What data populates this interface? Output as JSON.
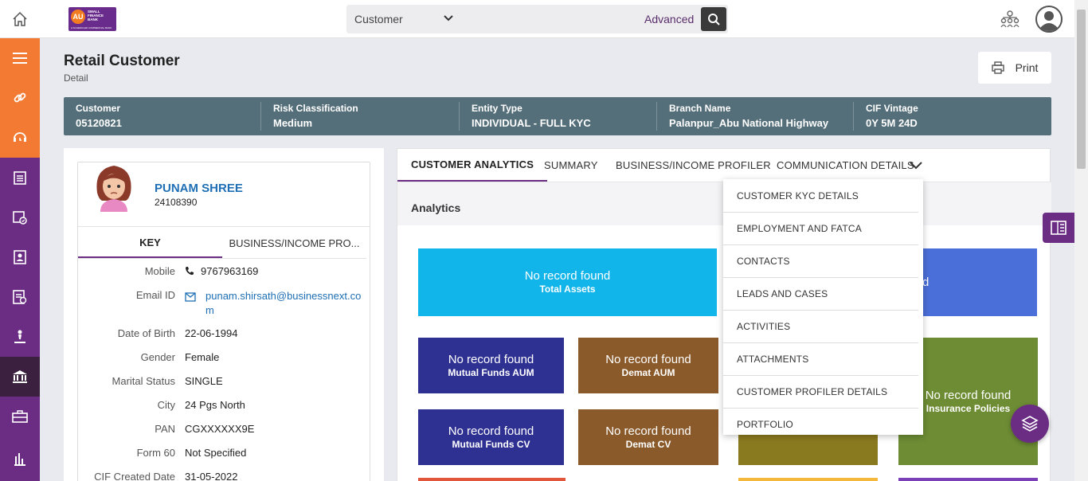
{
  "topbar": {
    "search_scope": "Customer",
    "search_placeholder": "",
    "advanced_label": "Advanced",
    "logo_text": "AU",
    "logo_bank": "SMALL FINANCE BANK",
    "logo_tagline": "A SCHEDULED COMMERCIAL BANK"
  },
  "sidebar": {
    "items": [
      {
        "icon": "menu-icon",
        "color": "#f37a33"
      },
      {
        "icon": "link-icon",
        "color": "#f37a33"
      },
      {
        "icon": "support-icon",
        "color": "#f37a33"
      },
      {
        "icon": "clipboard-icon",
        "color": "#6b2d84"
      },
      {
        "icon": "calendar-check-icon",
        "color": "#6b2d84"
      },
      {
        "icon": "id-card-icon",
        "color": "#6b2d84"
      },
      {
        "icon": "document-icon",
        "color": "#6b2d84"
      },
      {
        "icon": "person-lever-icon",
        "color": "#6b2d84"
      },
      {
        "icon": "bank-icon",
        "color": "#3c2040"
      },
      {
        "icon": "briefcase-icon",
        "color": "#6b2d84"
      },
      {
        "icon": "bar-chart-icon",
        "color": "#6b2d84"
      }
    ]
  },
  "page": {
    "title": "Retail Customer",
    "subtitle": "Detail",
    "print_label": "Print"
  },
  "info": {
    "customer_label": "Customer",
    "customer_value": "05120821",
    "risk_label": "Risk Classification",
    "risk_value": "Medium",
    "entity_label": "Entity Type",
    "entity_value": "INDIVIDUAL - FULL KYC",
    "branch_label": "Branch Name",
    "branch_value": "Palanpur_Abu National Highway",
    "vintage_label": "CIF Vintage",
    "vintage_value": "0Y 5M 24D"
  },
  "customer": {
    "name": "PUNAM SHREE",
    "id": "24108390",
    "tabs": [
      "KEY",
      "BUSINESS/INCOME PRO..."
    ],
    "fields": {
      "mobile_label": "Mobile",
      "mobile": "9767963169",
      "email_label": "Email ID",
      "email": "punam.shirsath@businessnext.com",
      "dob_label": "Date of Birth",
      "dob": "22-06-1994",
      "gender_label": "Gender",
      "gender": "Female",
      "marital_label": "Marital Status",
      "marital": "SINGLE",
      "city_label": "City",
      "city": "24 Pgs North",
      "pan_label": "PAN",
      "pan": "CGXXXXXX9E",
      "form60_label": "Form 60",
      "form60": "Not Specified",
      "cif_label": "CIF Created Date",
      "cif": "31-05-2022"
    }
  },
  "tabs": {
    "analytics": "CUSTOMER ANALYTICS",
    "summary": "SUMMARY",
    "business": "BUSINESS/INCOME PROFILER",
    "communication": "COMMUNICATION DETAILS"
  },
  "analytics": {
    "title": "Analytics",
    "no_record": "No record found",
    "partial_no_record": "d",
    "total_assets": "Total Assets",
    "mf_aum": "Mutual Funds AUM",
    "demat_aum": "Demat AUM",
    "insurance": "Insurance Policies",
    "mf_cv": "Mutual Funds CV",
    "demat_cv": "Demat CV",
    "colors": {
      "total_assets": "#12b5ea",
      "blue": "#4a6fd8",
      "navy": "#2e3192",
      "brown": "#8b5a2b",
      "green": "#6d8c34",
      "olive": "#8a7a1f"
    }
  },
  "dropdown": {
    "items": [
      "CUSTOMER KYC DETAILS",
      "EMPLOYMENT AND FATCA",
      "CONTACTS",
      "LEADS AND CASES",
      "ACTIVITIES",
      "ATTACHMENTS",
      "CUSTOMER PROFILER DETAILS",
      "PORTFOLIO"
    ]
  }
}
